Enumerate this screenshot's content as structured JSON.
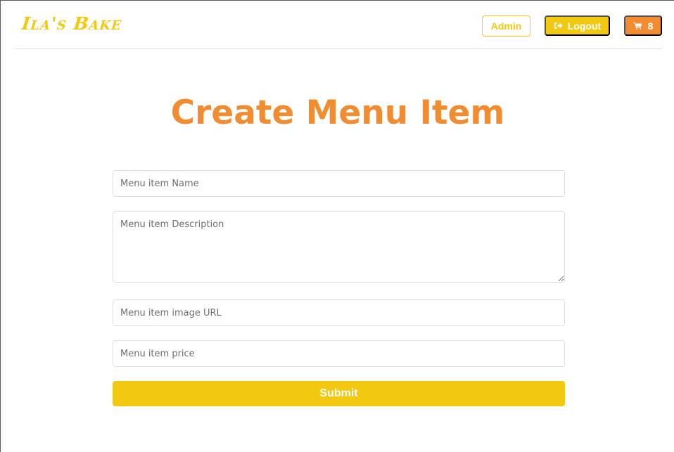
{
  "brand": {
    "name": "Ila's Bake",
    "color": "#f2c811"
  },
  "nav": {
    "admin_label": "Admin",
    "logout_label": "Logout",
    "logout_icon": "sign-out-icon",
    "cart_icon": "cart-icon",
    "cart_count": "8"
  },
  "page": {
    "title": "Create Menu Item",
    "title_color": "#f28c30"
  },
  "form": {
    "name_placeholder": "Menu item Name",
    "description_placeholder": "Menu item Description",
    "image_placeholder": "Menu item image URL",
    "price_placeholder": "Menu item price",
    "submit_label": "Submit"
  },
  "colors": {
    "accent_yellow": "#f2c811",
    "accent_orange": "#f28c30"
  }
}
